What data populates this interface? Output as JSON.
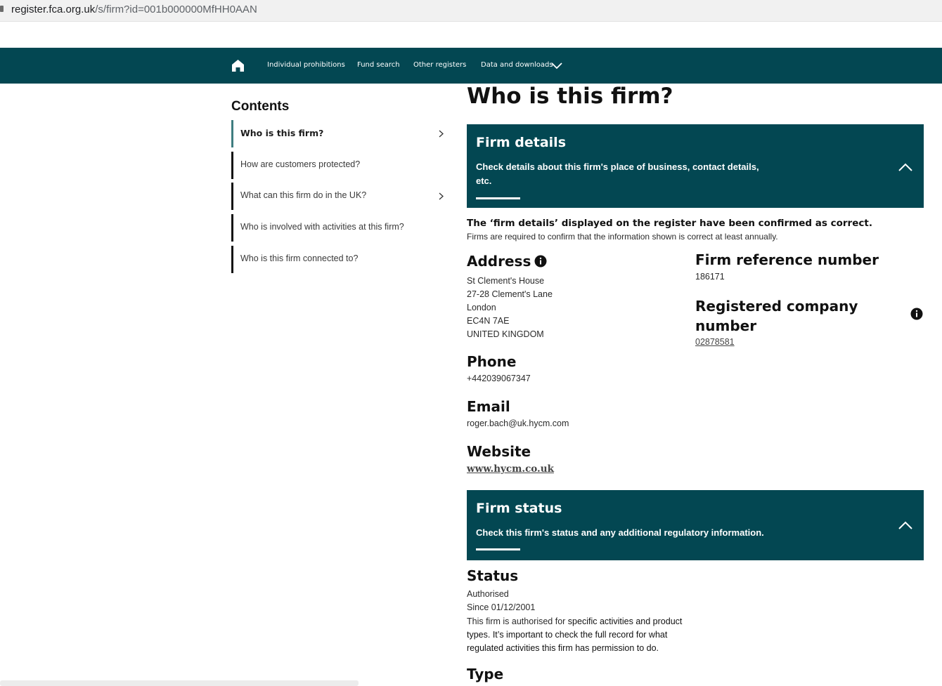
{
  "browser": {
    "url_host": "register.fca.org.uk",
    "url_path": "/s/firm?id=001b000000MfHH0AAN"
  },
  "nav": {
    "items": [
      "Individual prohibitions",
      "Fund search",
      "Other registers",
      "Data and downloads"
    ]
  },
  "contents": {
    "title": "Contents",
    "items": [
      "Who is this firm?",
      "How are customers protected?",
      "What can this firm do in the UK?",
      "Who is involved with activities at this firm?",
      "Who is this firm connected to?"
    ]
  },
  "main": {
    "title": "Who is this firm?",
    "firm_details_panel": {
      "title": "Firm details",
      "desc_line1": "Check details about this firm's place of business, contact details,",
      "desc_line2": "etc."
    },
    "confirm_bold": "The ‘firm details’ displayed on the register have been confirmed as correct.",
    "confirm_note": "Firms are required to confirm that the information shown is correct at least annually.",
    "address": {
      "heading": "Address",
      "lines": [
        "St Clement's House",
        "27-28 Clement's Lane",
        "London",
        "EC4N 7AE",
        "UNITED KINGDOM"
      ]
    },
    "frn": {
      "heading": "Firm reference number",
      "value": "186171"
    },
    "company": {
      "heading_line1": "Registered company",
      "heading_line2": "number",
      "value": "02878581"
    },
    "phone": {
      "heading": "Phone",
      "value": "+442039067347"
    },
    "email": {
      "heading": "Email",
      "value": "roger.bach@uk.hycm.com"
    },
    "website": {
      "heading": "Website",
      "value": "www.hycm.co.uk"
    },
    "firm_status_panel": {
      "title": "Firm status",
      "desc": "Check this firm's status and any additional regulatory information."
    },
    "status": {
      "heading": "Status",
      "value": "Authorised",
      "since": "Since 01/12/2001",
      "note_part1": "This firm is authorised for ",
      "note_part2": "specific activities and product types. It’s important to check the full record for what regulated activities this firm has permission to do."
    },
    "type": {
      "heading": "Type"
    }
  }
}
